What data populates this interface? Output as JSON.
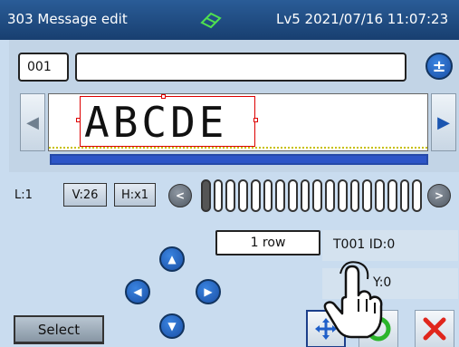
{
  "header": {
    "title": "303 Message edit",
    "status_icon": "eraser-icon",
    "datetime": "Lv5 2021/07/16 11:07:23"
  },
  "editor": {
    "message_number": "001",
    "message_name": "",
    "preview_text": "ABCDE",
    "progress_fraction": 1.0
  },
  "settings": {
    "line": "L:1",
    "v_size": "V:26",
    "h_size": "H:x1"
  },
  "char_strip": {
    "cell_count": 18
  },
  "rows_label": "1 row",
  "info": {
    "id_line": "T001   ID:0",
    "y_line": "Y:0"
  },
  "buttons": {
    "select_label": "Select"
  },
  "colors": {
    "header": "#1f4a80",
    "panel": "#c2d4e6",
    "accent_blue": "#1a4fa5",
    "ok_green": "#2cb52c",
    "cancel_red": "#e0261c"
  }
}
